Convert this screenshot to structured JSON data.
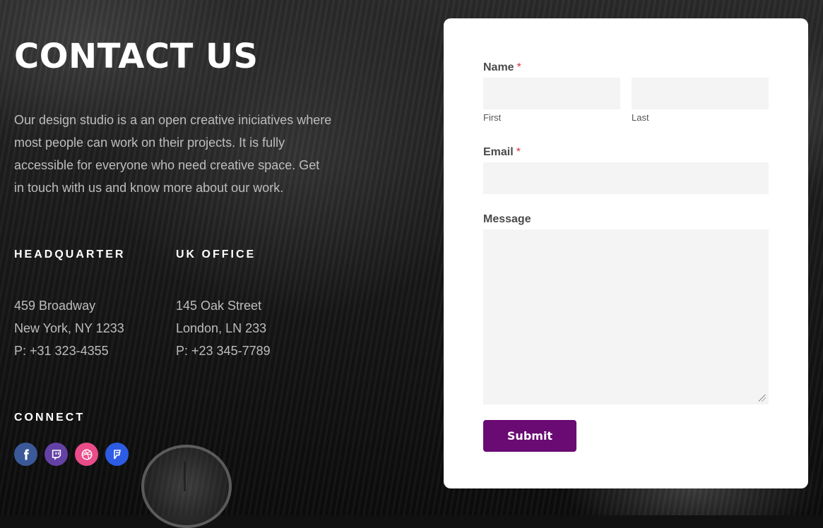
{
  "page": {
    "title": "CONTACT US",
    "intro": "Our design studio is a an open creative iniciatives where most people can work on their projects. It is fully accessible for everyone who need creative space. Get in touch with us and know more about our work."
  },
  "offices": {
    "hq": {
      "heading": "HEADQUARTER",
      "line1": "459 Broadway",
      "line2": "New York, NY 1233",
      "phone": "P: +31 323-4355"
    },
    "uk": {
      "heading": "UK OFFICE",
      "line1": "145 Oak Street",
      "line2": "London, LN 233",
      "phone": "P: +23 345-7789"
    }
  },
  "connect": {
    "heading": "CONNECT",
    "socials": [
      {
        "name": "facebook-icon",
        "color": "#3b5998"
      },
      {
        "name": "twitch-icon",
        "color": "#6441a5"
      },
      {
        "name": "dribbble-icon",
        "color": "#ea4c89"
      },
      {
        "name": "foursquare-icon",
        "color": "#2d5be3"
      }
    ]
  },
  "form": {
    "name_label": "Name",
    "required_mark": "*",
    "first_sublabel": "First",
    "last_sublabel": "Last",
    "first_value": "",
    "last_value": "",
    "email_label": "Email",
    "email_value": "",
    "message_label": "Message",
    "message_value": "",
    "submit_label": "Submit",
    "accent_color": "#6a0a73"
  }
}
